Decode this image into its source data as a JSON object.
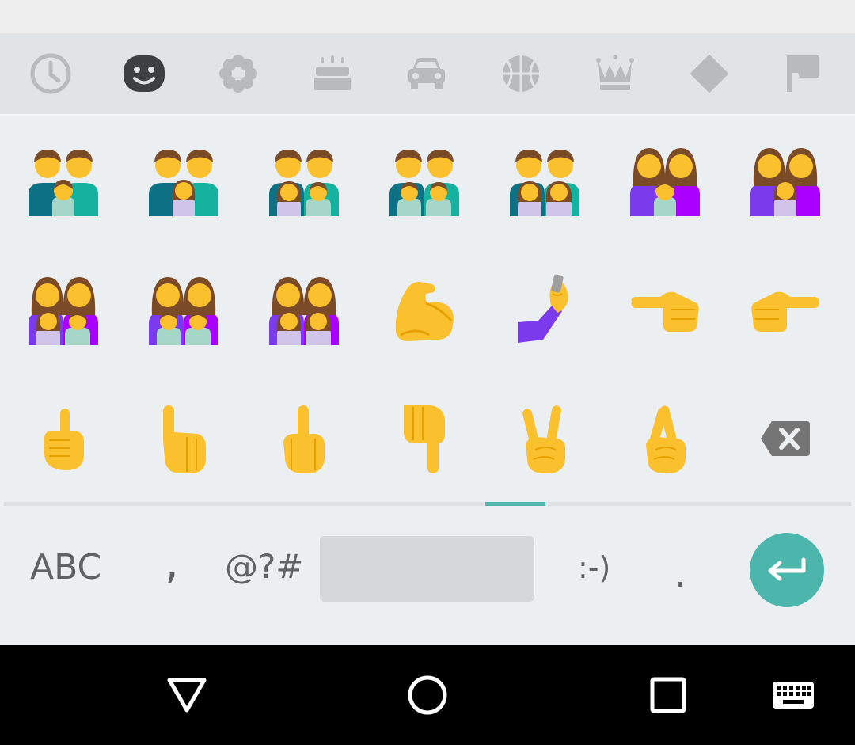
{
  "categories": [
    {
      "icon": "recent-clock-icon"
    },
    {
      "icon": "smiley-face-icon",
      "selected": true
    },
    {
      "icon": "flower-icon"
    },
    {
      "icon": "birthday-cake-icon"
    },
    {
      "icon": "car-icon"
    },
    {
      "icon": "basketball-icon"
    },
    {
      "icon": "crown-icon"
    },
    {
      "icon": "diamond-icon"
    },
    {
      "icon": "flag-icon"
    }
  ],
  "emoji_grid": [
    {
      "icon": "family-man-man-boy-emoji"
    },
    {
      "icon": "family-man-man-girl-emoji"
    },
    {
      "icon": "family-man-man-girl-boy-emoji"
    },
    {
      "icon": "family-man-man-boy-boy-emoji"
    },
    {
      "icon": "family-man-man-girl-girl-emoji"
    },
    {
      "icon": "family-woman-woman-boy-emoji"
    },
    {
      "icon": "family-woman-woman-girl-emoji"
    },
    {
      "icon": "family-woman-woman-girl-boy-emoji"
    },
    {
      "icon": "family-woman-woman-boy-boy-emoji"
    },
    {
      "icon": "family-woman-woman-girl-girl-emoji"
    },
    {
      "icon": "flexed-biceps-emoji"
    },
    {
      "icon": "selfie-emoji"
    },
    {
      "icon": "backhand-index-pointing-left-emoji"
    },
    {
      "icon": "backhand-index-pointing-right-emoji"
    },
    {
      "icon": "index-pointing-up-emoji"
    },
    {
      "icon": "backhand-index-pointing-up-emoji"
    },
    {
      "icon": "middle-finger-emoji"
    },
    {
      "icon": "backhand-index-pointing-down-emoji"
    },
    {
      "icon": "victory-hand-emoji"
    },
    {
      "icon": "crossed-fingers-emoji"
    },
    {
      "icon": "backspace-icon"
    }
  ],
  "page_indicator": {
    "pages": 7,
    "current": 5
  },
  "bottom_row": {
    "abc": "ABC",
    "comma": ",",
    "symbols": "@?#",
    "emoticon": ":-)",
    "period": ".",
    "enter_icon": "enter-arrow-icon"
  },
  "navbar": [
    "back-triangle-icon",
    "home-circle-icon",
    "recents-square-icon",
    "keyboard-icon"
  ],
  "colors": {
    "accent": "#4db6ac",
    "key_text": "#5f6368",
    "icon_gray": "#b8bbbe",
    "selected_icon": "#3c4043",
    "emoji_yellow": "#fbc02d"
  }
}
